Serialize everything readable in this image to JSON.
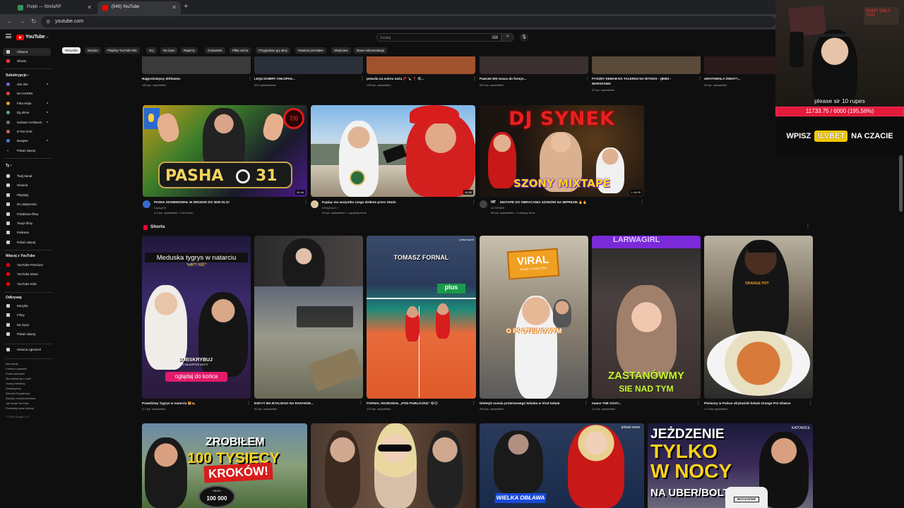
{
  "browser": {
    "tabs": [
      {
        "title": "Pulpit — StrefaRP",
        "active": false
      },
      {
        "title": "(549) YouTube",
        "active": true
      }
    ],
    "url": "youtube.com"
  },
  "youtube": {
    "logo_text": "YouTube",
    "logo_sup": "PL",
    "search_placeholder": "Szukaj"
  },
  "sidebar": {
    "main": [
      {
        "label": "Główna",
        "icon": "home-icon",
        "active": true
      },
      {
        "label": "Shorts",
        "icon": "shorts-icon",
        "active": false
      }
    ],
    "subs_heading": "Subskrypcje",
    "subs": [
      {
        "label": "xbe xbe",
        "color": "#8a5cf6",
        "dot": true
      },
      {
        "label": "NA HAPEK",
        "color": "#e44",
        "dot": false
      },
      {
        "label": "Fala Hejtu",
        "color": "#f0a030",
        "dot": true
      },
      {
        "label": "Dg slims",
        "color": "#5a8",
        "dot": true
      },
      {
        "label": "Kulowe Archiwum",
        "color": "#777",
        "dot": true
      },
      {
        "label": "IFYM Chef",
        "color": "#c66",
        "dot": false
      },
      {
        "label": "Bungee",
        "color": "#48c",
        "dot": true
      },
      {
        "label": "Pokaż więcej",
        "color": "",
        "dot": false
      }
    ],
    "you_heading": "Ty",
    "you": [
      {
        "label": "Twój kanał",
        "icon": "channel-icon"
      },
      {
        "label": "Historia",
        "icon": "history-icon"
      },
      {
        "label": "Playlisty",
        "icon": "playlist-icon"
      },
      {
        "label": "Do obejrzenia",
        "icon": "watch-later-icon"
      },
      {
        "label": "Polubione filmy",
        "icon": "like-icon"
      },
      {
        "label": "Twoje filmy",
        "icon": "your-videos-icon"
      },
      {
        "label": "Pobrane",
        "icon": "download-icon"
      },
      {
        "label": "Pokaż więcej",
        "icon": "chevron-down-icon"
      }
    ],
    "more_heading": "Więcej z YouTube",
    "more": [
      {
        "label": "YouTube Premium"
      },
      {
        "label": "YouTube Music"
      },
      {
        "label": "YouTube Kids"
      }
    ],
    "explore_heading": "Odkrywaj",
    "explore": [
      {
        "label": "Muzyka",
        "icon": "music-icon"
      },
      {
        "label": "Filmy",
        "icon": "film-icon"
      },
      {
        "label": "Na żywo",
        "icon": "live-icon"
      },
      {
        "label": "Pokaż więcej",
        "icon": "chevron-down-icon"
      }
    ],
    "report": "Historia zgłoszeń",
    "footer": [
      "Informacje",
      "Centrum prasowe",
      "Prawa autorskie",
      "Skontaktuj się z nami",
      "Twórcy   Reklamy",
      "Deweloperzy",
      "Warunki   Prywatność",
      "Zasady i bezpieczeństwo",
      "Jak działa YouTube",
      "Przetestuj nowe funkcje"
    ],
    "copyright": "© 2025 Google LLC"
  },
  "chips": [
    "Wszystko",
    "Muzyka",
    "Playlisty YouTube Mix",
    "Gry",
    "Na żywo",
    "Raperzy",
    "Gotowanie",
    "Piłka nożna",
    "Przygodowe gry akcji",
    "Ostatnio przesłane",
    "Obejrzane",
    "Nowe rekomendacje"
  ],
  "top_row": [
    {
      "title": "Najgroźniejszy drillowiec",
      "meta": "196 tys. wyświetleń"
    },
    {
      "title": "LEQU DOBRY CHŁOPAK...",
      "meta": "522 wyświetlenia"
    },
    {
      "title": "petarda na ostrzu noża 🧨 🔪 ❓ 😨...",
      "meta": "198 tys. wyświetleń"
    },
    {
      "title": "Pawcek WK wraca do formy!...",
      "meta": "553 tys. wyświetleń"
    },
    {
      "title": "PYSZNY KEBAB NA TALERZU NA WYNOS - QEBS -",
      "title2": "WARSZAWA",
      "meta": "23 tys. wyświetleń"
    },
    {
      "title": "URATOWAŁA ŚWIAT?...",
      "meta": "34 tys. wyświetleń"
    }
  ],
  "videos": [
    {
      "title": "PASHA ZDOMINOWAŁ W DRODZE DO 3000 ELO!",
      "channel": "CudnyCS",
      "meta": "2,3 tys. wyświetleń • 4 dni temu",
      "duration": "42:46",
      "thumb_text": "PASHA",
      "thumb_num": "31",
      "corner": "7/0"
    },
    {
      "title": "Kupiąc mu wszystko czego dotknie przez 15min",
      "channel": "KSIĄŻULO ✓",
      "meta": "93 tys. wyświetleń • 1 godzinę temu",
      "duration": "40:40"
    },
    {
      "title": "MIXTAPE DO OBRACANIA SZONÓW NA IMPREZIE 🔥🔥",
      "channel": "DJ SYNEK",
      "meta": "89 tys. wyświetleń • 1 miesiąc temu",
      "duration": "1:16:39",
      "thumb_top": "DJ SYNEK",
      "thumb_bottom": "SZONY MIXTAPE"
    }
  ],
  "shorts_heading": "Shorts",
  "shorts": [
    {
      "title": "Prawdziwy Tygrys w natarciu 🐯🐅",
      "meta": "3,7 tys. wyświetleń",
      "top": "Meduska tygrys w natarciu",
      "sub": "*ełłł?! NIE*",
      "cta1": "SUBSKRYBUJ",
      "cta1b": "PO NAJLEPSZE SZOTY",
      "cta2": "oglądaj do końca"
    },
    {
      "title": "ESKYY MA BYALIEGO NA RADARZE...",
      "meta": "52 tys. wyświetleń"
    },
    {
      "title": "FORNAL ROZEGRAŁ „POD PUBLICZKĘ\" 😂😊",
      "meta": "132 tys. wyświetleń",
      "top": "TOMASZ FORNAL",
      "brand": "polsat sport"
    },
    {
      "title": "Dietetyk ocenia proteinowego kebaba w Viral Kebab",
      "meta": "259 tys. wyświetleń",
      "sign": "VIRAL",
      "sign_sub": "Kebab & Crispy Fries",
      "caption": "O PROTEINOWYM"
    },
    {
      "title": "mamo THE GOAT...",
      "meta": "2,8 tys. wyświetleń",
      "top": "LARWAGIRL",
      "bottom1": "ZASTANÓWMY",
      "bottom2": "SIE NAD TYM"
    },
    {
      "title": "Pierwszy w Polsce afrykański kebab Orange Pot Gliwice",
      "meta": "1,3 mln wyświetleń",
      "apron": "ORANGE POT"
    }
  ],
  "bottom_row": [
    {
      "line1": "ZROBIŁEM",
      "line2": "100 TYSIĘCY",
      "line3": "KROKÓW!",
      "badge": "100 000",
      "badge_label": "KROKI"
    },
    {},
    {
      "label": "WIELKA OBŁAWA",
      "brand": "polsat news"
    },
    {
      "line1": "JEŻDZENIE",
      "line2": "TYLKO",
      "line3": "W NOCY",
      "line4": "NA UBER/BOLT",
      "plate": "BIGSZOFER",
      "place": "KATOWICE"
    }
  ],
  "overlay": {
    "goal_text": "please sir 10 rupes",
    "goal_value": "11733.75 / 6000 (195,56%)",
    "goal_fraction": 1.0,
    "promo_prefix": "WPISZ",
    "promo_code": "!LVBET",
    "promo_suffix": "NA CZACIE",
    "poster": "DONT ONLY YOU"
  },
  "colors": {
    "accent": "#ff0000",
    "goal": "#e31b3b",
    "promo_code": "#f3c900"
  }
}
